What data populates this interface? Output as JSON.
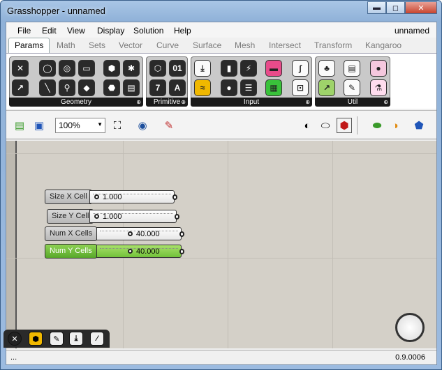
{
  "window": {
    "title": "Grasshopper - unnamed",
    "minimize": "▬",
    "maximize": "◻",
    "close": "✕"
  },
  "menu": {
    "items": [
      "File",
      "Edit",
      "View",
      "Display",
      "Solution",
      "Help"
    ],
    "document": "unnamed"
  },
  "tabs": [
    "Params",
    "Math",
    "Sets",
    "Vector",
    "Curve",
    "Surface",
    "Mesh",
    "Intersect",
    "Transform",
    "Kangaroo"
  ],
  "ribbon": {
    "groups": [
      "Geometry",
      "Primitive",
      "Input",
      "Util"
    ],
    "expand": "⊕"
  },
  "toolbar": {
    "zoom": "100%",
    "zoom_arrow": "▼"
  },
  "sliders": [
    {
      "label": "Size X Cell",
      "value": "1.000"
    },
    {
      "label": "Size Y Cell",
      "value": "1.000"
    },
    {
      "label": "Num X Cells",
      "value": "40.000"
    },
    {
      "label": "Num Y Cells",
      "value": "40.000"
    }
  ],
  "status": {
    "left": "...",
    "version": "0.9.0006"
  },
  "colors": {
    "selected": "#6dbf3a",
    "canvas": "#d4d0c8"
  }
}
